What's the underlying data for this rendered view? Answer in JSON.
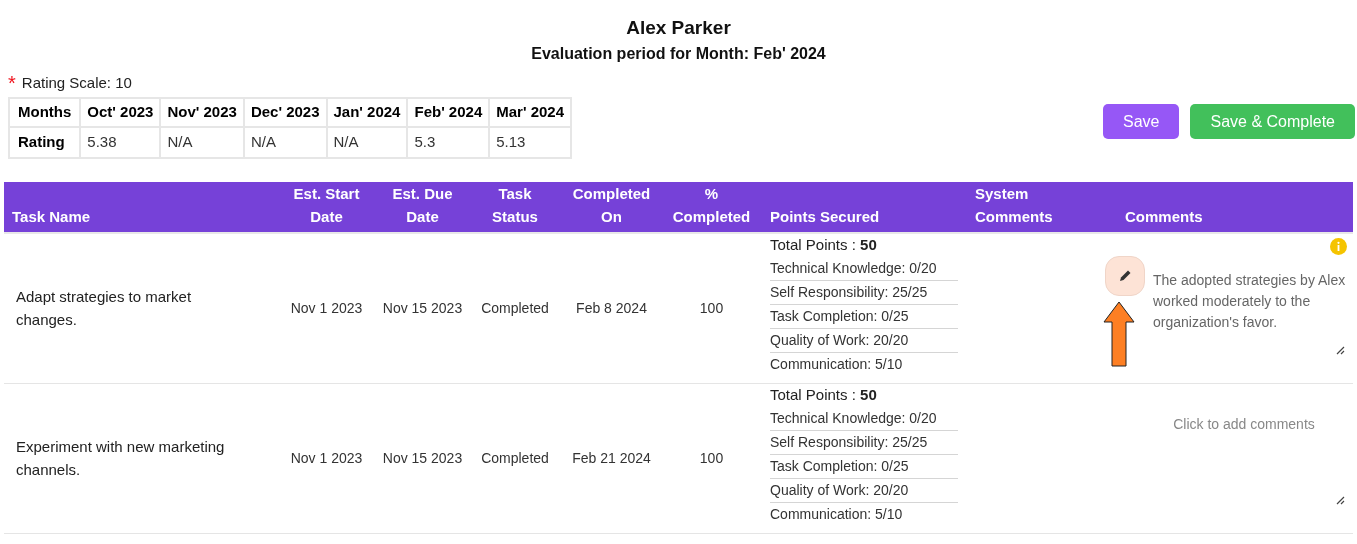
{
  "employee_name": "Alex Parker",
  "evaluation_period": "Evaluation period for Month: Feb' 2024",
  "rating_scale": {
    "marker": "*",
    "label": "Rating Scale: 10"
  },
  "ratings_table": {
    "row_headers": [
      "Months",
      "Rating"
    ],
    "columns": [
      {
        "month": "Oct' 2023",
        "rating": "5.38"
      },
      {
        "month": "Nov' 2023",
        "rating": "N/A"
      },
      {
        "month": "Dec' 2023",
        "rating": "N/A"
      },
      {
        "month": "Jan' 2024",
        "rating": "N/A"
      },
      {
        "month": "Feb' 2024",
        "rating": "5.3"
      },
      {
        "month": "Mar' 2024",
        "rating": "5.13"
      }
    ]
  },
  "buttons": [
    {
      "label": "Save",
      "kind": "primary"
    },
    {
      "label": "Save & Complete",
      "kind": "success"
    }
  ],
  "tasks_table": {
    "columns": [
      [
        "Task Name"
      ],
      [
        "Est. Start",
        "Date"
      ],
      [
        "Est. Due",
        "Date"
      ],
      [
        "Task",
        "Status"
      ],
      [
        "Completed",
        "On"
      ],
      [
        "%",
        "Completed"
      ],
      [
        "Points Secured"
      ],
      [
        "System",
        "Comments"
      ],
      [
        "Comments"
      ]
    ],
    "rows": [
      {
        "task_name": "Adapt strategies to market changes.",
        "start": "Nov 1 2023",
        "due": "Nov 15 2023",
        "status": "Completed",
        "completed_on": "Feb 8 2024",
        "percent": "100",
        "total_label": "Total Points :",
        "total": "50",
        "points": [
          "Technical Knowledge: 0/20",
          "Self Responsibility: 25/25",
          "Task Completion: 0/25",
          "Quality of Work: 20/20",
          "Communication: 5/10"
        ],
        "comment": "The adopted strategies by Alex worked moderately to the organization's favor.",
        "editing": true
      },
      {
        "task_name": "Experiment with new marketing channels.",
        "start": "Nov 1 2023",
        "due": "Nov 15 2023",
        "status": "Completed",
        "completed_on": "Feb 21 2024",
        "percent": "100",
        "total_label": "Total Points :",
        "total": "50",
        "points": [
          "Technical Knowledge: 0/20",
          "Self Responsibility: 25/25",
          "Task Completion: 0/25",
          "Quality of Work: 20/20",
          "Communication: 5/10"
        ],
        "placeholder": "Click to add comments",
        "editing": false
      }
    ]
  }
}
